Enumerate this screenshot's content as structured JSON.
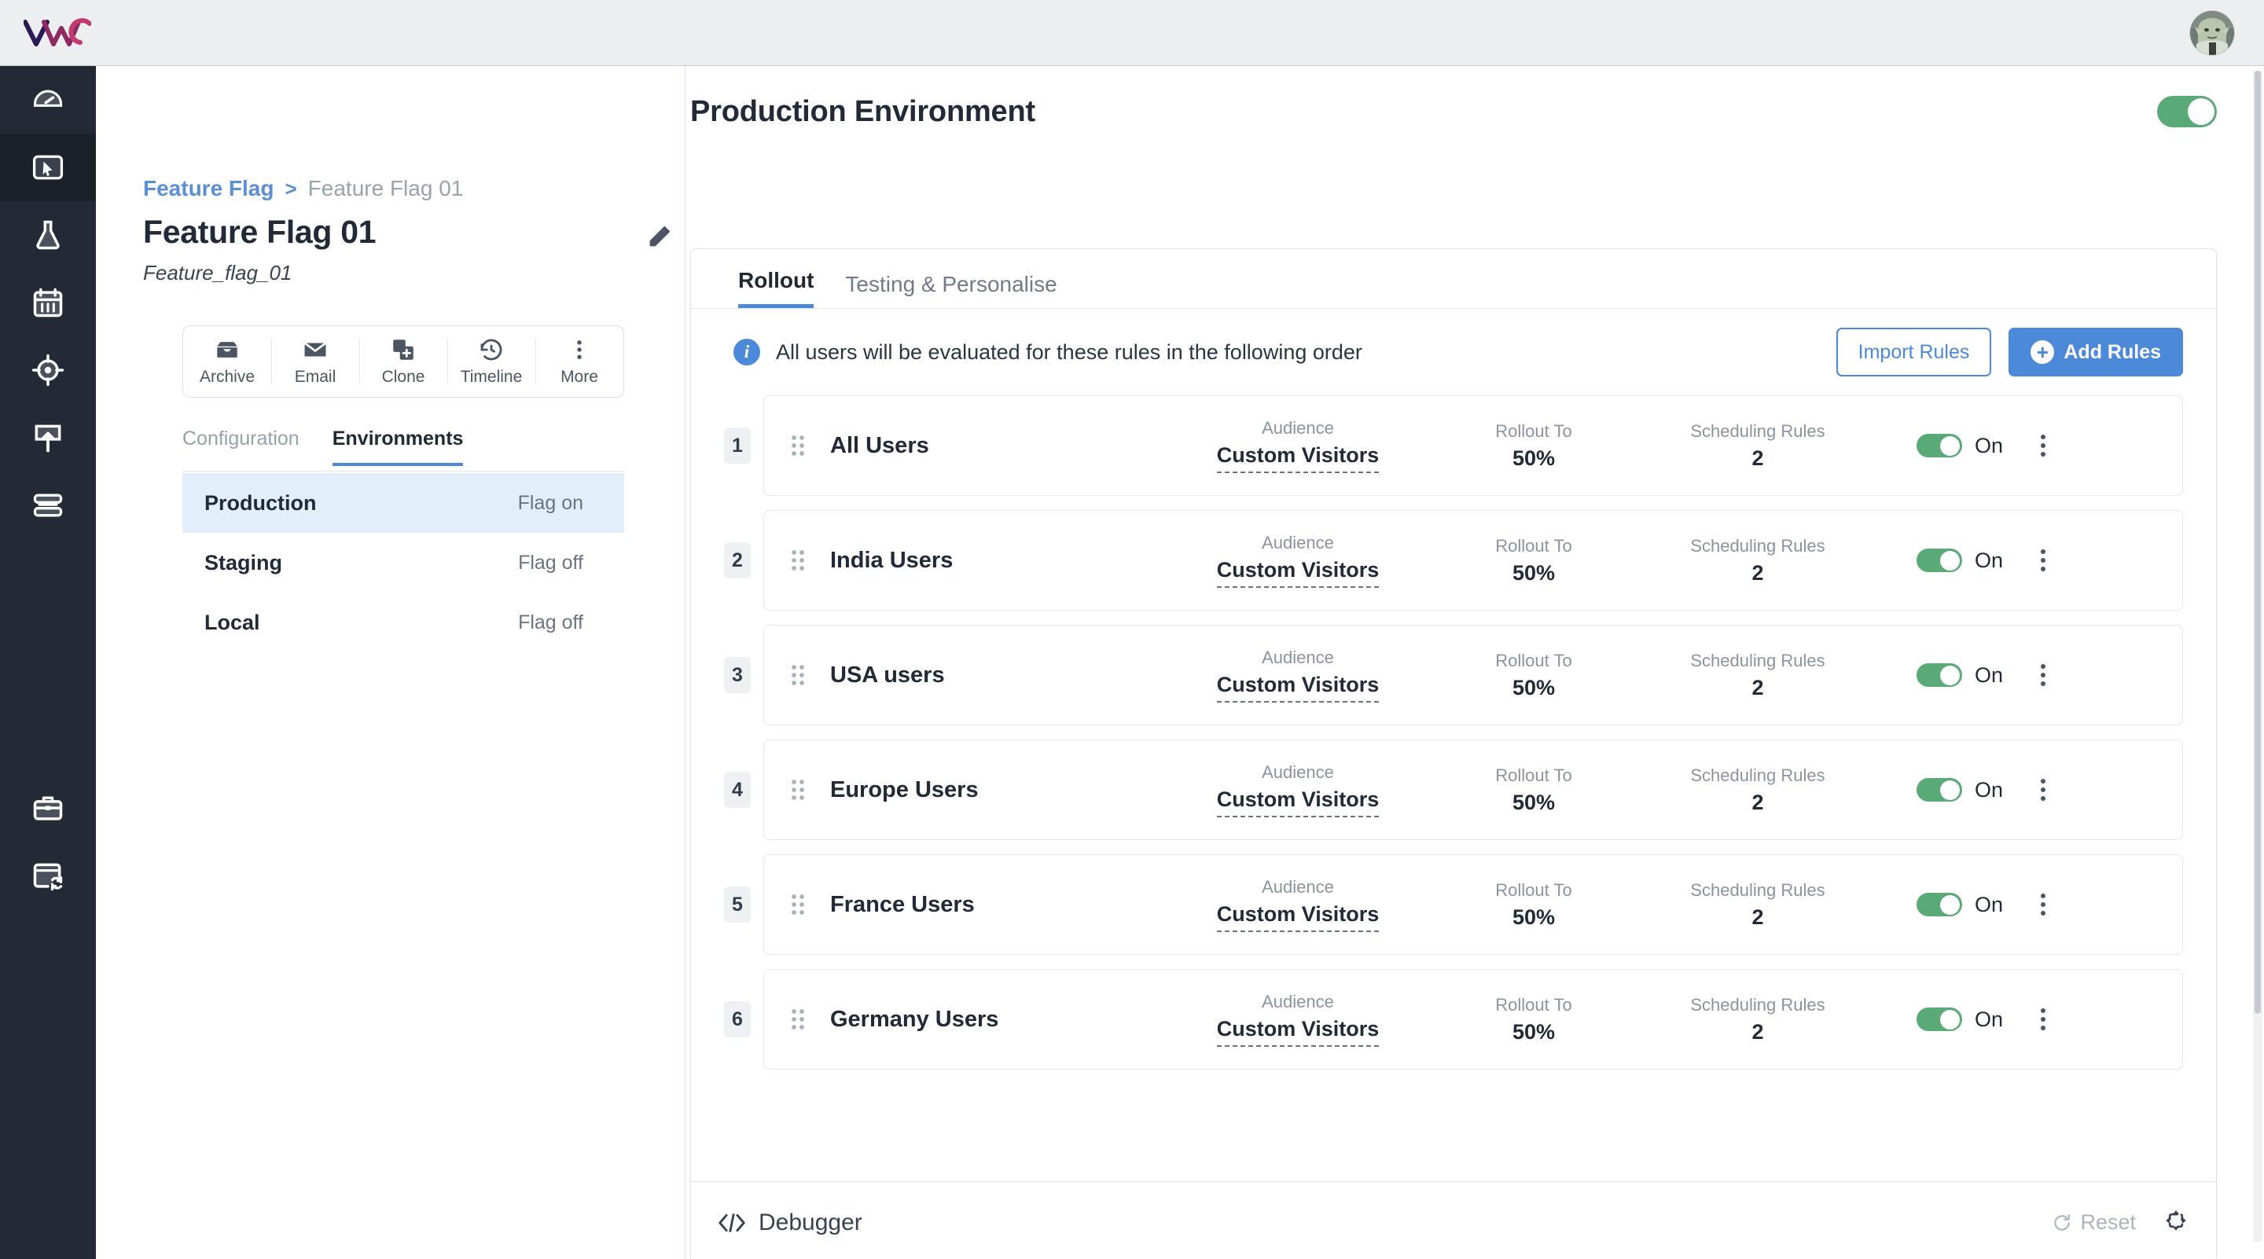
{
  "brand": {
    "logo_text": "VWO",
    "logo_colors": [
      "#2b1a56",
      "#7b2a63",
      "#c43b72"
    ]
  },
  "topbar": {
    "avatar_alt": "user-avatar"
  },
  "rail": {
    "items": [
      {
        "name": "dashboard",
        "icon": "speedometer-icon",
        "active": false
      },
      {
        "name": "insights",
        "icon": "cursor-screen-icon",
        "active": true
      },
      {
        "name": "testing",
        "icon": "flask-icon",
        "active": false
      },
      {
        "name": "plan",
        "icon": "calendar-icon",
        "active": false
      },
      {
        "name": "targeting",
        "icon": "crosshair-icon",
        "active": false
      },
      {
        "name": "deploy",
        "icon": "upload-box-icon",
        "active": false
      },
      {
        "name": "data",
        "icon": "layers-icon",
        "active": false
      },
      {
        "name": "toolbox",
        "icon": "toolbox-icon",
        "active": false
      },
      {
        "name": "sync",
        "icon": "window-sync-icon",
        "active": false
      }
    ]
  },
  "breadcrumb": {
    "root": "Feature Flag",
    "separator": ">",
    "current": "Feature Flag 01"
  },
  "flag": {
    "title": "Feature Flag 01",
    "key": "Feature_flag_01",
    "edit_icon": "pencil-icon"
  },
  "actions": [
    {
      "label": "Archive",
      "icon": "archive-icon"
    },
    {
      "label": "Email",
      "icon": "envelope-icon"
    },
    {
      "label": "Clone",
      "icon": "copy-plus-icon"
    },
    {
      "label": "Timeline",
      "icon": "history-clock-icon"
    },
    {
      "label": "More",
      "icon": "kebab-icon"
    }
  ],
  "left_tabs": [
    {
      "label": "Configuration",
      "active": false
    },
    {
      "label": "Environments",
      "active": true
    }
  ],
  "environments": [
    {
      "name": "Production",
      "state": "Flag on",
      "active": true
    },
    {
      "name": "Staging",
      "state": "Flag off",
      "active": false
    },
    {
      "name": "Local",
      "state": "Flag off",
      "active": false
    }
  ],
  "main": {
    "title": "Production Environment",
    "env_toggle_state": "on",
    "tabs": [
      {
        "label": "Rollout",
        "active": true
      },
      {
        "label": "Testing & Personalise",
        "active": false
      }
    ],
    "info_banner": {
      "icon": "info-icon",
      "text": "All users will be evaluated for these rules in the following order"
    },
    "buttons": {
      "import": "Import Rules",
      "add": "Add Rules",
      "add_icon": "plus-circle-icon"
    },
    "columns": {
      "audience": "Audience",
      "rollout": "Rollout To",
      "scheduling": "Scheduling Rules"
    },
    "rules": [
      {
        "rank": "1",
        "name": "All Users",
        "audience": "Custom Visitors",
        "rollout": "50%",
        "scheduling": "2",
        "state": "On"
      },
      {
        "rank": "2",
        "name": "India Users",
        "audience": "Custom Visitors",
        "rollout": "50%",
        "scheduling": "2",
        "state": "On"
      },
      {
        "rank": "3",
        "name": "USA users",
        "audience": "Custom Visitors",
        "rollout": "50%",
        "scheduling": "2",
        "state": "On"
      },
      {
        "rank": "4",
        "name": "Europe Users",
        "audience": "Custom Visitors",
        "rollout": "50%",
        "scheduling": "2",
        "state": "On"
      },
      {
        "rank": "5",
        "name": "France Users",
        "audience": "Custom Visitors",
        "rollout": "50%",
        "scheduling": "2",
        "state": "On"
      },
      {
        "rank": "6",
        "name": "Germany Users",
        "audience": "Custom Visitors",
        "rollout": "50%",
        "scheduling": "2",
        "state": "On"
      }
    ],
    "debugger": {
      "label": "Debugger",
      "icon": "code-brackets-icon",
      "reset": "Reset",
      "reset_icon": "refresh-icon",
      "expand_icon": "expand-arrows-icon"
    }
  },
  "colors": {
    "accent_blue": "#4c89d8",
    "toggle_green": "#5aaa77",
    "rail_dark": "#242a35",
    "text_dark": "#222a37",
    "muted": "#8b93a0"
  }
}
